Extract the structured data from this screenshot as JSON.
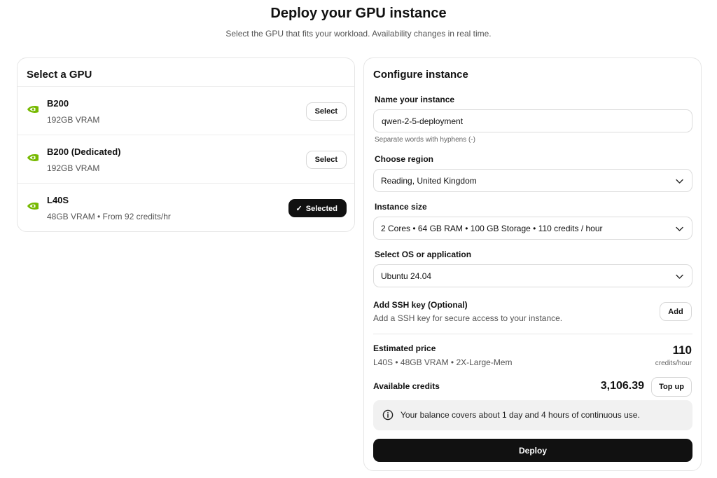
{
  "header": {
    "title": "Deploy your GPU instance",
    "subtitle": "Select the GPU that fits your workload. Availability changes in real time."
  },
  "gpu_panel": {
    "title": "Select a GPU",
    "items": [
      {
        "name": "B200",
        "spec": "192GB VRAM",
        "button": "Select",
        "selected": false,
        "logo_icon": "nvidia-logo-icon"
      },
      {
        "name": "B200 (Dedicated)",
        "spec": "192GB VRAM",
        "button": "Select",
        "selected": false,
        "logo_icon": "nvidia-logo-icon"
      },
      {
        "name": "L40S",
        "spec": "48GB VRAM • From 92 credits/hr",
        "button": "Selected",
        "selected": true,
        "logo_icon": "nvidia-logo-icon"
      }
    ]
  },
  "config": {
    "title": "Configure instance",
    "name_label": "Name your instance",
    "name_value": "qwen-2-5-deployment",
    "name_hint": "Separate words with hyphens (-)",
    "region_label": "Choose region",
    "region_value": "Reading, United Kingdom",
    "size_label": "Instance size",
    "size_value": "2 Cores • 64 GB RAM • 100 GB Storage • 110 credits / hour",
    "os_label": "Select OS or application",
    "os_value": "Ubuntu 24.04",
    "ssh_title": "Add SSH key (Optional)",
    "ssh_desc": "Add a SSH key for secure access to your instance.",
    "ssh_button": "Add",
    "price_label": "Estimated price",
    "price_detail": "L40S • 48GB VRAM • 2X-Large-Mem",
    "price_value": "110",
    "price_unit": "credits/hour",
    "credits_label": "Available credits",
    "credits_value": "3,106.39",
    "topup_button": "Top up",
    "info_text": "Your balance covers about 1 day and 4 hours of continuous use.",
    "deploy_button": "Deploy"
  },
  "colors": {
    "accent": "#111111",
    "nvidia_green": "#76b900",
    "info_bg": "#f1f1f1",
    "border": "#e6e6e6"
  }
}
